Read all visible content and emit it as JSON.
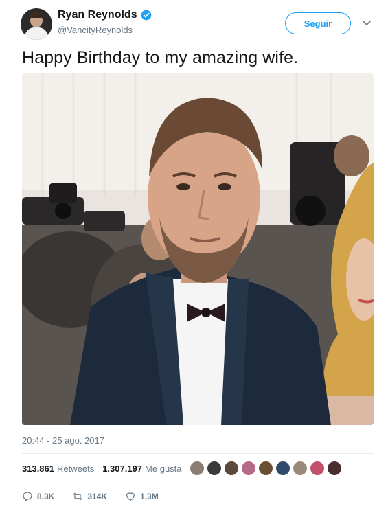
{
  "user": {
    "display_name": "Ryan Reynolds",
    "handle": "@VancityReynolds",
    "verified": true
  },
  "follow_button": {
    "label": "Seguir"
  },
  "tweet": {
    "text": "Happy Birthday to my amazing wife.",
    "timestamp": "20:44 - 25 ago. 2017"
  },
  "stats": {
    "retweets_count": "313.861",
    "retweets_label": "Retweets",
    "likes_count": "1.307.197",
    "likes_label": "Me gusta"
  },
  "liker_avatars": [
    {
      "color": "#8a7d74"
    },
    {
      "color": "#3c3a3a"
    },
    {
      "color": "#5a4a3c"
    },
    {
      "color": "#b56a8a"
    },
    {
      "color": "#6a4e36"
    },
    {
      "color": "#2f4a6a"
    },
    {
      "color": "#9a8a7a"
    },
    {
      "color": "#c2506a"
    },
    {
      "color": "#4a2e2e"
    }
  ],
  "actions": {
    "reply_count": "8,3K",
    "retweet_count": "314K",
    "like_count": "1,3M"
  },
  "icons": {
    "verified": "verified-badge-icon",
    "chevron": "chevron-down-icon",
    "reply": "reply-icon",
    "retweet": "retweet-icon",
    "like": "heart-icon"
  },
  "colors": {
    "accent": "#1da1f2",
    "secondary_text": "#657786",
    "primary_text": "#14171a",
    "divider": "#e6ecf0"
  }
}
